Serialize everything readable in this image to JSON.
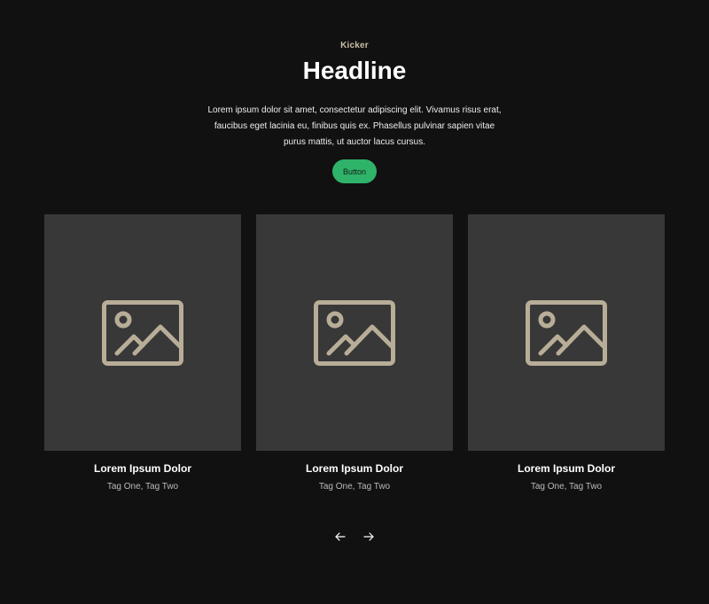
{
  "hero": {
    "kicker": "Kicker",
    "headline": "Headline",
    "body": "Lorem ipsum dolor sit amet, consectetur adipiscing elit. Vivamus risus erat, faucibus eget lacinia eu, finibus quis ex. Phasellus pulvinar sapien vitae purus mattis, ut auctor lacus cursus.",
    "button_label": "Button"
  },
  "cards": [
    {
      "title": "Lorem Ipsum Dolor",
      "tags": "Tag One, Tag Two",
      "image_icon": "image-placeholder-icon"
    },
    {
      "title": "Lorem Ipsum Dolor",
      "tags": "Tag One, Tag Two",
      "image_icon": "image-placeholder-icon"
    },
    {
      "title": "Lorem Ipsum Dolor",
      "tags": "Tag One, Tag Two",
      "image_icon": "image-placeholder-icon"
    }
  ],
  "carousel": {
    "prev_icon": "arrow-left-icon",
    "next_icon": "arrow-right-icon"
  },
  "colors": {
    "background": "#111111",
    "kicker": "#c9bfa6",
    "accent": "#2fb36a",
    "card_media": "#383838",
    "icon": "#b8ad97"
  }
}
